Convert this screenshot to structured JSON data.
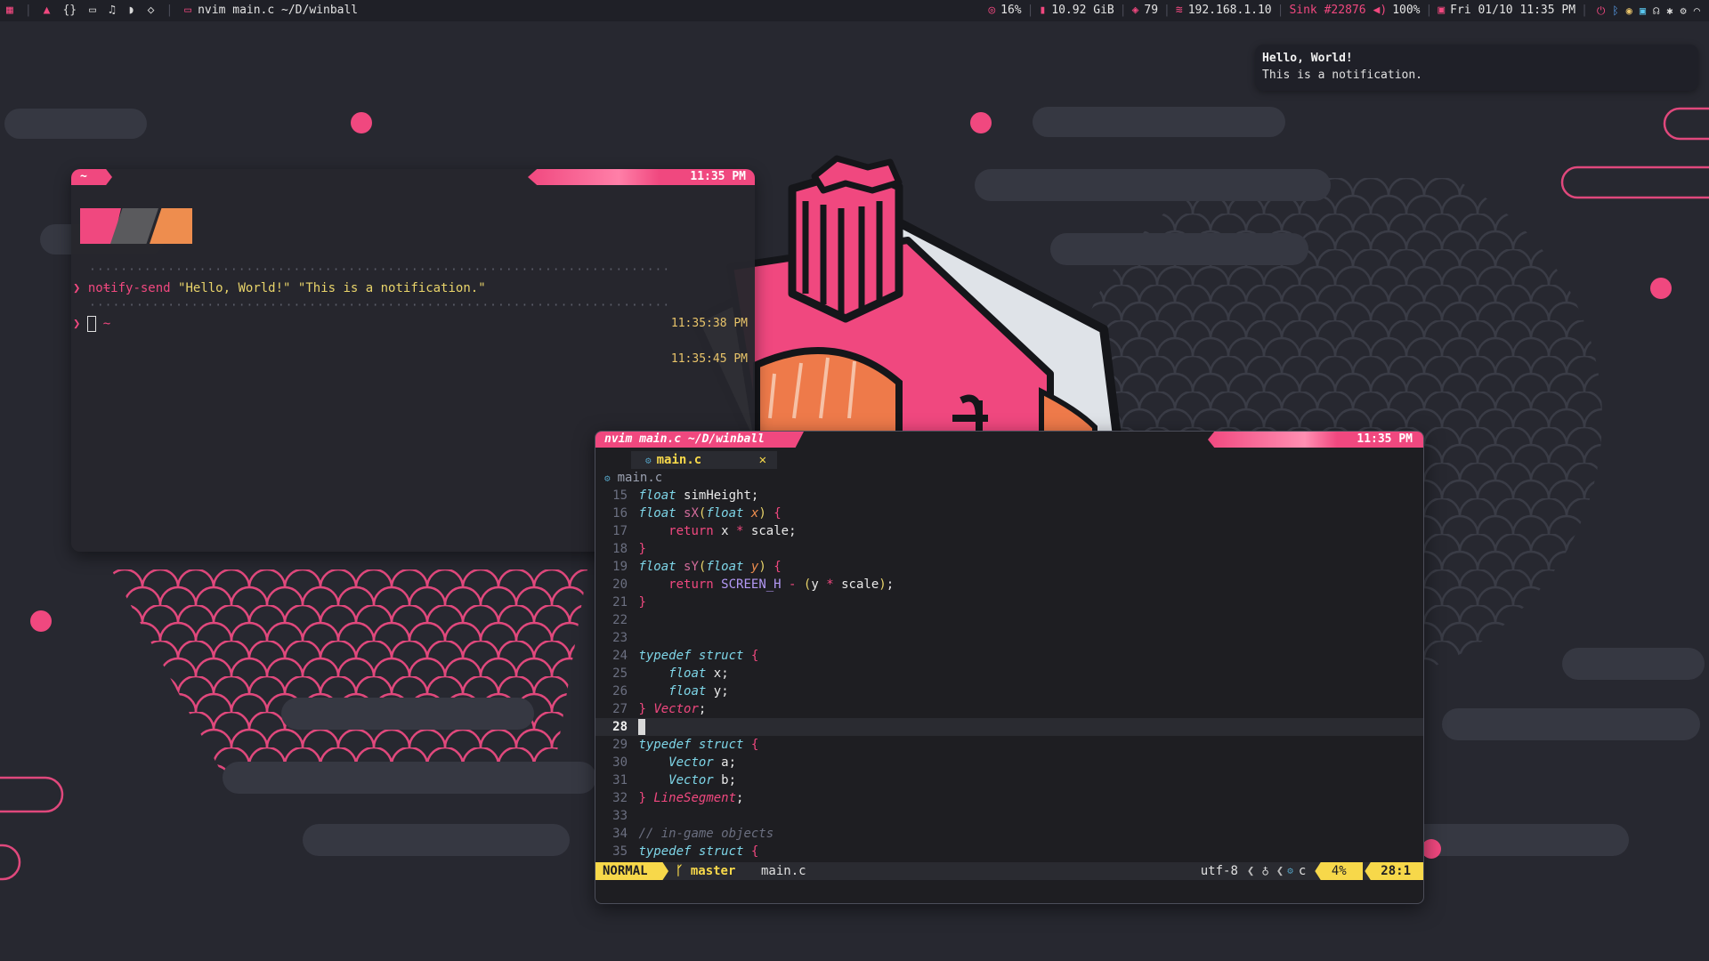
{
  "topbar": {
    "workspace_icons": [
      "grid-icon",
      "arch-icon",
      "braces-icon",
      "chat-icon",
      "music-icon",
      "gamepad-icon",
      "diamond-icon"
    ],
    "window_title": "nvim main.c ~/D/winball",
    "cpu": "16%",
    "memory": "10.92 GiB",
    "packages": "79",
    "ip": "192.168.1.10",
    "sink": "Sink #22876",
    "volume": "100%",
    "datetime": "Fri 01/10 11:35 PM"
  },
  "notification": {
    "title": "Hello, World!",
    "body": "This is a notification."
  },
  "terminal": {
    "tab_label": "~",
    "clock": "11:35 PM",
    "lines": [
      {
        "dir": "~",
        "time": "11:35:38 PM"
      },
      {
        "command": "notify-send",
        "arg1": "\"Hello, World!\"",
        "arg2": "\"This is a notification.\""
      },
      {
        "dir": "~",
        "time": "11:35:45 PM"
      }
    ],
    "prompt": "❯"
  },
  "nvim": {
    "title": "nvim main.c ~/D/winball",
    "clock": "11:35 PM",
    "buffer_tab": "main.c",
    "winbar": "main.c",
    "lines": [
      15,
      16,
      17,
      18,
      19,
      20,
      21,
      22,
      23,
      24,
      25,
      26,
      27,
      28,
      29,
      30,
      31,
      32,
      33,
      34,
      35
    ],
    "tokens": {
      "float": "float",
      "return": "return",
      "typedef": "typedef",
      "struct": "struct",
      "simHeight": "simHeight",
      "sX": "sX",
      "sY": "sY",
      "x": "x",
      "y": "y",
      "scale": "scale",
      "SCREEN_H": "SCREEN_H",
      "Vector": "Vector",
      "LineSegment": "LineSegment",
      "a": "a",
      "b": "b",
      "comment": "// in-game objects"
    },
    "statusline": {
      "mode": "NORMAL",
      "branch": "master",
      "file": "main.c",
      "encoding": "utf-8",
      "filetype": "c",
      "percent": "4%",
      "position": "28:1"
    }
  },
  "colors": {
    "accent_pink": "#f0487f",
    "accent_yellow": "#f7d84a",
    "accent_orange": "#ee8d4e",
    "background": "#272830"
  }
}
